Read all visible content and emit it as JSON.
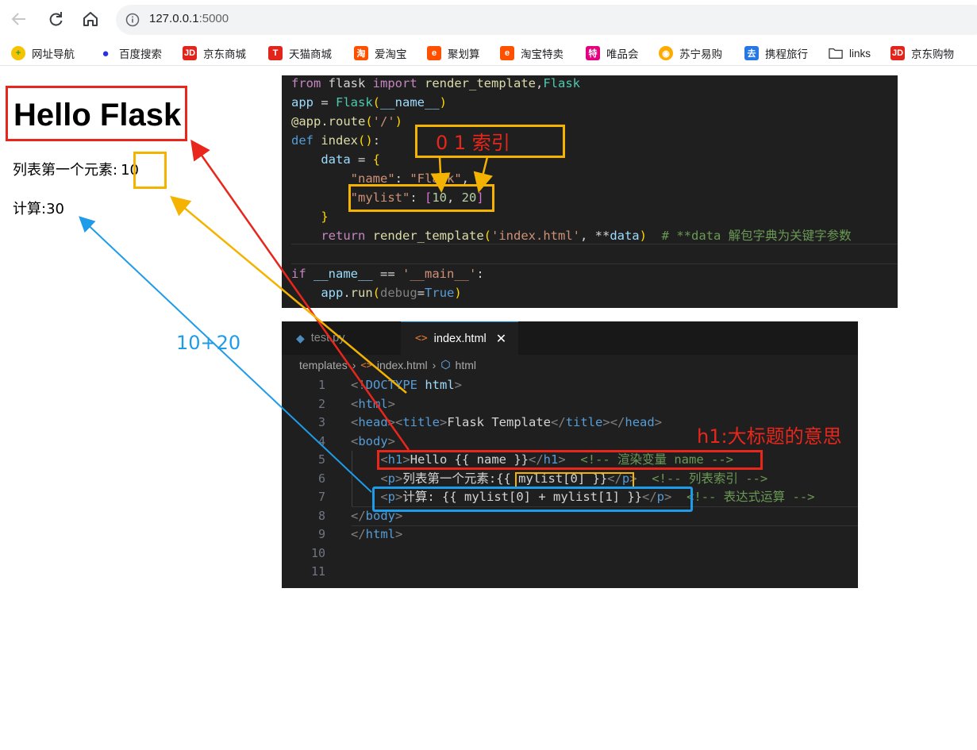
{
  "browser": {
    "url_host": "127.0.0.1",
    "url_port": ":5000",
    "bookmarks": [
      {
        "label": "网址导航",
        "icon": "plus-circle-icon",
        "color": "#2a9d3a"
      },
      {
        "label": "百度搜索",
        "icon": "baidu-paw-icon",
        "color": "#2932e1"
      },
      {
        "label": "京东商城",
        "icon": "jd-icon",
        "color": "#e1251b"
      },
      {
        "label": "天猫商城",
        "icon": "tmall-icon",
        "color": "#e1251b"
      },
      {
        "label": "爱淘宝",
        "icon": "taobao-icon",
        "color": "#ff5000"
      },
      {
        "label": "聚划算",
        "icon": "juhuasuan-icon",
        "color": "#ff5000"
      },
      {
        "label": "淘宝特卖",
        "icon": "taobao-sale-icon",
        "color": "#ff5000"
      },
      {
        "label": "唯品会",
        "icon": "vip-icon",
        "color": "#e4007f"
      },
      {
        "label": "苏宁易购",
        "icon": "suning-icon",
        "color": "#ffaa00"
      },
      {
        "label": "携程旅行",
        "icon": "ctrip-icon",
        "color": "#2577e3"
      },
      {
        "label": "links",
        "icon": "folder-icon",
        "color": "#5f6368"
      },
      {
        "label": "京东购物",
        "icon": "jd-icon",
        "color": "#e1251b"
      }
    ]
  },
  "page": {
    "h1": "Hello Flask",
    "p1_label": "列表第一个元素:",
    "p1_value": "10",
    "p2": "计算:30"
  },
  "editor_top": {
    "lines": [
      "from flask import render_template,Flask",
      "app = Flask(__name__)",
      "@app.route('/')",
      "def index():",
      "    data = {",
      "        \"name\": \"Flask\",",
      "        \"mylist\": [10, 20]",
      "    }",
      "    return render_template('index.html', **data)  # **data 解包字典为关键字参数",
      "",
      "if __name__ == '__main__':",
      "    app.run(debug=True)"
    ]
  },
  "editor_bottom": {
    "tabs": [
      "test.py",
      "index.html"
    ],
    "breadcrumbs": [
      "templates",
      "index.html",
      "html"
    ],
    "line_numbers": [
      "1",
      "2",
      "3",
      "4",
      "5",
      "6",
      "7",
      "8",
      "9",
      "10",
      "11"
    ]
  },
  "annotations": {
    "index_label": "0    1   索引",
    "h1_note": "h1:大标题的意思",
    "sum_note": "10+20",
    "colors": {
      "red": "#e8261b",
      "orange": "#f5b301",
      "blue": "#1e9be9"
    }
  }
}
